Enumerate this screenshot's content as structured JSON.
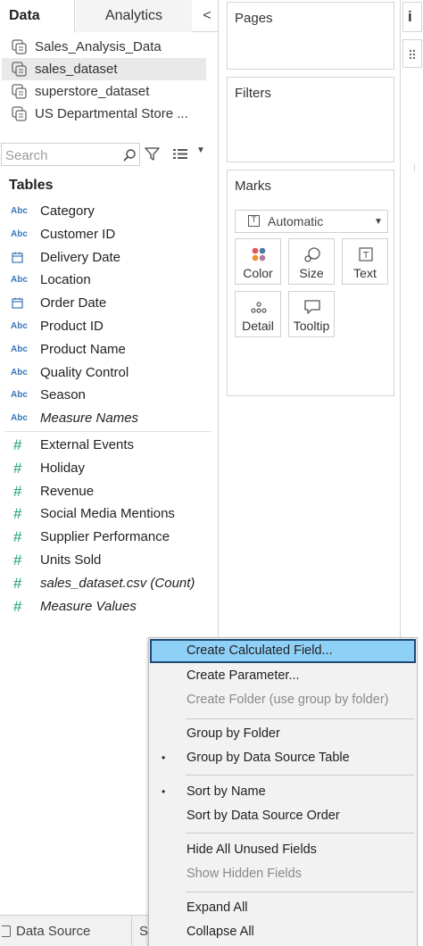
{
  "tabs": {
    "data": "Data",
    "analytics": "Analytics",
    "collapse": "<"
  },
  "data_sources": [
    {
      "label": "Sales_Analysis_Data",
      "selected": false
    },
    {
      "label": "sales_dataset",
      "selected": true
    },
    {
      "label": "superstore_dataset",
      "selected": false
    },
    {
      "label": "US Departmental Store ...",
      "selected": false
    }
  ],
  "search": {
    "placeholder": "Search"
  },
  "tables_title": "Tables",
  "dimensions": [
    {
      "label": "Category",
      "type": "Abc"
    },
    {
      "label": "Customer ID",
      "type": "Abc"
    },
    {
      "label": "Delivery Date",
      "type": "date"
    },
    {
      "label": "Location",
      "type": "Abc"
    },
    {
      "label": "Order Date",
      "type": "date"
    },
    {
      "label": "Product ID",
      "type": "Abc"
    },
    {
      "label": "Product Name",
      "type": "Abc"
    },
    {
      "label": "Quality Control",
      "type": "Abc"
    },
    {
      "label": "Season",
      "type": "Abc"
    },
    {
      "label": "Measure Names",
      "type": "Abc",
      "italic": true
    }
  ],
  "measures": [
    {
      "label": "External Events",
      "type": "#"
    },
    {
      "label": "Holiday",
      "type": "#"
    },
    {
      "label": "Revenue",
      "type": "#"
    },
    {
      "label": "Social Media Mentions",
      "type": "#"
    },
    {
      "label": "Supplier Performance",
      "type": "#"
    },
    {
      "label": "Units Sold",
      "type": "#"
    },
    {
      "label": "sales_dataset.csv (Count)",
      "type": "#",
      "italic": true
    },
    {
      "label": "Measure Values",
      "type": "#",
      "italic": true
    }
  ],
  "abc_label": "Abc",
  "hash_label": "#",
  "shelves": {
    "pages": "Pages",
    "filters": "Filters",
    "marks": "Marks"
  },
  "marks": {
    "type_select": "Automatic",
    "cards": [
      {
        "label": "Color",
        "icon": "color-icon"
      },
      {
        "label": "Size",
        "icon": "size-icon"
      },
      {
        "label": "Text",
        "icon": "text-icon"
      },
      {
        "label": "Detail",
        "icon": "detail-icon"
      },
      {
        "label": "Tooltip",
        "icon": "tooltip-icon"
      }
    ]
  },
  "bottom_bar": {
    "data_source_tab": "Data Source",
    "sheet_tab": "S"
  },
  "right_strip": {
    "glyph": "i"
  },
  "context_menu": {
    "items": [
      {
        "label": "Create Calculated Field...",
        "highlight": true
      },
      {
        "label": "Create Parameter..."
      },
      {
        "label": "Create Folder (use group by folder)",
        "disabled": true
      },
      {
        "label": "Group by Folder"
      },
      {
        "label": "Group by Data Source Table",
        "checked": true
      },
      {
        "label": "Sort by Name",
        "checked": true
      },
      {
        "label": "Sort by Data Source Order"
      },
      {
        "label": "Hide All Unused Fields"
      },
      {
        "label": "Show Hidden Fields",
        "disabled": true
      },
      {
        "label": "Expand All"
      },
      {
        "label": "Collapse All"
      }
    ],
    "bullet": "•"
  },
  "colors": {
    "highlight": "#8fd0f6",
    "highlight_border": "#1d4a73",
    "dimension_blue": "#3a77b6",
    "measure_green": "#1b9e77"
  }
}
